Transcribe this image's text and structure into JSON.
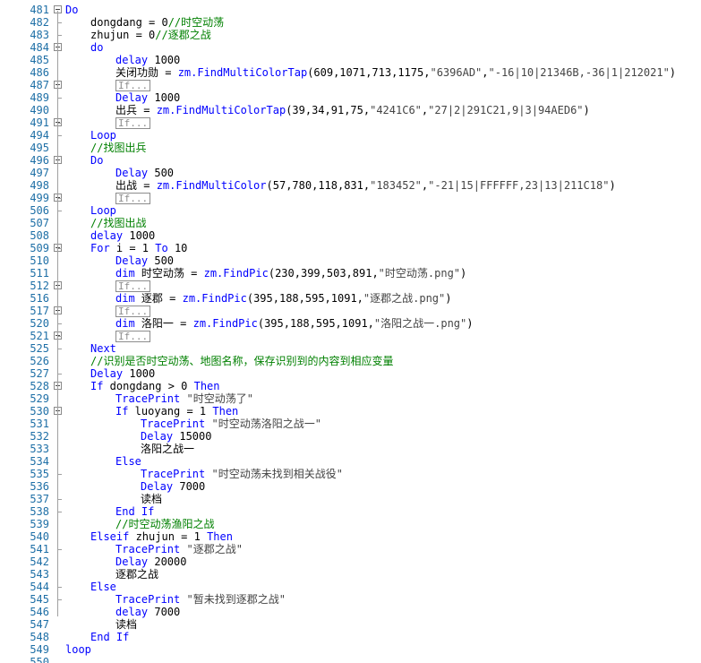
{
  "editor": {
    "lines": [
      {
        "n": "481",
        "indent": 0,
        "fold": true,
        "parts": [
          {
            "t": "kw",
            "v": "Do"
          }
        ]
      },
      {
        "n": "482",
        "indent": 1,
        "parts": [
          {
            "t": "plain",
            "v": "dongdang = 0"
          },
          {
            "t": "cm",
            "v": "//时空动荡"
          }
        ]
      },
      {
        "n": "483",
        "indent": 1,
        "parts": [
          {
            "t": "plain",
            "v": "zhujun = 0"
          },
          {
            "t": "cm",
            "v": "//逐郡之战"
          }
        ]
      },
      {
        "n": "484",
        "indent": 1,
        "fold": true,
        "parts": [
          {
            "t": "kw",
            "v": "do"
          }
        ]
      },
      {
        "n": "485",
        "indent": 2,
        "parts": [
          {
            "t": "kw",
            "v": "delay"
          },
          {
            "t": "plain",
            "v": " 1000"
          }
        ]
      },
      {
        "n": "486",
        "indent": 2,
        "parts": [
          {
            "t": "plain",
            "v": "关闭功勋 = "
          },
          {
            "t": "obj",
            "v": "zm.FindMultiColorTap"
          },
          {
            "t": "plain",
            "v": "(609,1071,713,1175,"
          },
          {
            "t": "str",
            "v": "\"6396AD\""
          },
          {
            "t": "plain",
            "v": ","
          },
          {
            "t": "str",
            "v": "\"-16|10|21346B,-36|1|212021\""
          },
          {
            "t": "plain",
            "v": ")"
          }
        ]
      },
      {
        "n": "487",
        "indent": 2,
        "fold": true,
        "parts": [
          {
            "t": "box",
            "v": "If..."
          }
        ]
      },
      {
        "n": "489",
        "indent": 2,
        "parts": [
          {
            "t": "kw",
            "v": "Delay"
          },
          {
            "t": "plain",
            "v": " 1000"
          }
        ]
      },
      {
        "n": "490",
        "indent": 2,
        "parts": [
          {
            "t": "plain",
            "v": "出兵 = "
          },
          {
            "t": "obj",
            "v": "zm.FindMultiColorTap"
          },
          {
            "t": "plain",
            "v": "(39,34,91,75,"
          },
          {
            "t": "str",
            "v": "\"4241C6\""
          },
          {
            "t": "plain",
            "v": ","
          },
          {
            "t": "str",
            "v": "\"27|2|291C21,9|3|94AED6\""
          },
          {
            "t": "plain",
            "v": ")"
          }
        ]
      },
      {
        "n": "491",
        "indent": 2,
        "fold": true,
        "parts": [
          {
            "t": "box",
            "v": "If..."
          }
        ]
      },
      {
        "n": "494",
        "indent": 1,
        "parts": [
          {
            "t": "kw",
            "v": "Loop"
          }
        ]
      },
      {
        "n": "495",
        "indent": 1,
        "parts": [
          {
            "t": "cm",
            "v": "//找图出兵"
          }
        ]
      },
      {
        "n": "496",
        "indent": 1,
        "fold": true,
        "parts": [
          {
            "t": "kw",
            "v": "Do"
          }
        ]
      },
      {
        "n": "497",
        "indent": 2,
        "parts": [
          {
            "t": "kw",
            "v": "Delay"
          },
          {
            "t": "plain",
            "v": " 500"
          }
        ]
      },
      {
        "n": "498",
        "indent": 2,
        "parts": [
          {
            "t": "plain",
            "v": "出战 = "
          },
          {
            "t": "obj",
            "v": "zm.FindMultiColor"
          },
          {
            "t": "plain",
            "v": "(57,780,118,831,"
          },
          {
            "t": "str",
            "v": "\"183452\""
          },
          {
            "t": "plain",
            "v": ","
          },
          {
            "t": "str",
            "v": "\"-21|15|FFFFFF,23|13|211C18\""
          },
          {
            "t": "plain",
            "v": ")"
          }
        ]
      },
      {
        "n": "499",
        "indent": 2,
        "fold": true,
        "parts": [
          {
            "t": "box",
            "v": "If..."
          }
        ]
      },
      {
        "n": "506",
        "indent": 1,
        "parts": [
          {
            "t": "kw",
            "v": "Loop"
          }
        ]
      },
      {
        "n": "507",
        "indent": 1,
        "parts": [
          {
            "t": "cm",
            "v": "//找图出战"
          }
        ]
      },
      {
        "n": "508",
        "indent": 1,
        "parts": [
          {
            "t": "kw",
            "v": "delay"
          },
          {
            "t": "plain",
            "v": " 1000"
          }
        ]
      },
      {
        "n": "509",
        "indent": 1,
        "fold": true,
        "parts": [
          {
            "t": "kw",
            "v": "For"
          },
          {
            "t": "plain",
            "v": " i = 1 "
          },
          {
            "t": "kw",
            "v": "To"
          },
          {
            "t": "plain",
            "v": " 10"
          }
        ]
      },
      {
        "n": "510",
        "indent": 2,
        "parts": [
          {
            "t": "kw",
            "v": "Delay"
          },
          {
            "t": "plain",
            "v": " 500"
          }
        ]
      },
      {
        "n": "511",
        "indent": 2,
        "parts": [
          {
            "t": "kw",
            "v": "dim"
          },
          {
            "t": "plain",
            "v": " 时空动荡 = "
          },
          {
            "t": "obj",
            "v": "zm.FindPic"
          },
          {
            "t": "plain",
            "v": "(230,399,503,891,"
          },
          {
            "t": "str",
            "v": "\"时空动荡.png\""
          },
          {
            "t": "plain",
            "v": ")"
          }
        ]
      },
      {
        "n": "512",
        "indent": 2,
        "fold": true,
        "parts": [
          {
            "t": "box",
            "v": "If..."
          }
        ]
      },
      {
        "n": "516",
        "indent": 2,
        "parts": [
          {
            "t": "kw",
            "v": "dim"
          },
          {
            "t": "plain",
            "v": " 逐郡 = "
          },
          {
            "t": "obj",
            "v": "zm.FindPic"
          },
          {
            "t": "plain",
            "v": "(395,188,595,1091,"
          },
          {
            "t": "str",
            "v": "\"逐郡之战.png\""
          },
          {
            "t": "plain",
            "v": ")"
          }
        ]
      },
      {
        "n": "517",
        "indent": 2,
        "fold": true,
        "parts": [
          {
            "t": "box",
            "v": "If..."
          }
        ]
      },
      {
        "n": "520",
        "indent": 2,
        "parts": [
          {
            "t": "kw",
            "v": "dim"
          },
          {
            "t": "plain",
            "v": " 洛阳一 = "
          },
          {
            "t": "obj",
            "v": "zm.FindPic"
          },
          {
            "t": "plain",
            "v": "(395,188,595,1091,"
          },
          {
            "t": "str",
            "v": "\"洛阳之战一.png\""
          },
          {
            "t": "plain",
            "v": ")"
          }
        ]
      },
      {
        "n": "521",
        "indent": 2,
        "fold": true,
        "parts": [
          {
            "t": "box",
            "v": "If..."
          }
        ]
      },
      {
        "n": "525",
        "indent": 1,
        "parts": [
          {
            "t": "kw",
            "v": "Next"
          }
        ]
      },
      {
        "n": "526",
        "indent": 1,
        "parts": [
          {
            "t": "cm",
            "v": "//识别是否时空动荡、地图名称，保存识别到的内容到相应变量"
          }
        ]
      },
      {
        "n": "527",
        "indent": 1,
        "parts": [
          {
            "t": "kw",
            "v": "Delay"
          },
          {
            "t": "plain",
            "v": " 1000"
          }
        ]
      },
      {
        "n": "528",
        "indent": 1,
        "fold": true,
        "parts": [
          {
            "t": "kw",
            "v": "If"
          },
          {
            "t": "plain",
            "v": " dongdang > 0 "
          },
          {
            "t": "kw",
            "v": "Then"
          }
        ]
      },
      {
        "n": "529",
        "indent": 2,
        "parts": [
          {
            "t": "kw",
            "v": "TracePrint"
          },
          {
            "t": "str",
            "v": " \"时空动荡了\""
          }
        ]
      },
      {
        "n": "530",
        "indent": 2,
        "fold": true,
        "parts": [
          {
            "t": "kw",
            "v": "If"
          },
          {
            "t": "plain",
            "v": " luoyang = 1 "
          },
          {
            "t": "kw",
            "v": "Then"
          }
        ]
      },
      {
        "n": "531",
        "indent": 3,
        "parts": [
          {
            "t": "kw",
            "v": "TracePrint"
          },
          {
            "t": "str",
            "v": " \"时空动荡洛阳之战一\""
          }
        ]
      },
      {
        "n": "532",
        "indent": 3,
        "parts": [
          {
            "t": "kw",
            "v": "Delay"
          },
          {
            "t": "plain",
            "v": " 15000"
          }
        ]
      },
      {
        "n": "533",
        "indent": 3,
        "parts": [
          {
            "t": "plain",
            "v": "洛阳之战一"
          }
        ]
      },
      {
        "n": "534",
        "indent": 2,
        "parts": [
          {
            "t": "kw",
            "v": "Else"
          }
        ]
      },
      {
        "n": "535",
        "indent": 3,
        "parts": [
          {
            "t": "kw",
            "v": "TracePrint"
          },
          {
            "t": "str",
            "v": " \"时空动荡未找到相关战役\""
          }
        ]
      },
      {
        "n": "536",
        "indent": 3,
        "parts": [
          {
            "t": "kw",
            "v": "Delay"
          },
          {
            "t": "plain",
            "v": " 7000"
          }
        ]
      },
      {
        "n": "537",
        "indent": 3,
        "parts": [
          {
            "t": "plain",
            "v": "读档"
          }
        ]
      },
      {
        "n": "538",
        "indent": 2,
        "parts": [
          {
            "t": "kw",
            "v": "End If"
          }
        ]
      },
      {
        "n": "539",
        "indent": 2,
        "parts": [
          {
            "t": "cm",
            "v": "//时空动荡渔阳之战"
          }
        ]
      },
      {
        "n": "540",
        "indent": 1,
        "parts": [
          {
            "t": "kw",
            "v": "Elseif"
          },
          {
            "t": "plain",
            "v": " zhujun = 1 "
          },
          {
            "t": "kw",
            "v": "Then"
          }
        ]
      },
      {
        "n": "541",
        "indent": 2,
        "parts": [
          {
            "t": "kw",
            "v": "TracePrint"
          },
          {
            "t": "str",
            "v": " \"逐郡之战\""
          }
        ]
      },
      {
        "n": "542",
        "indent": 2,
        "parts": [
          {
            "t": "kw",
            "v": "Delay"
          },
          {
            "t": "plain",
            "v": " 20000"
          }
        ]
      },
      {
        "n": "543",
        "indent": 2,
        "parts": [
          {
            "t": "plain",
            "v": "逐郡之战"
          }
        ]
      },
      {
        "n": "544",
        "indent": 1,
        "parts": [
          {
            "t": "kw",
            "v": "Else"
          }
        ]
      },
      {
        "n": "545",
        "indent": 2,
        "parts": [
          {
            "t": "kw",
            "v": "TracePrint"
          },
          {
            "t": "str",
            "v": " \"暂未找到逐郡之战\""
          }
        ]
      },
      {
        "n": "546",
        "indent": 2,
        "parts": [
          {
            "t": "kw",
            "v": "delay"
          },
          {
            "t": "plain",
            "v": " 7000"
          }
        ]
      },
      {
        "n": "547",
        "indent": 2,
        "parts": [
          {
            "t": "plain",
            "v": "读档"
          }
        ]
      },
      {
        "n": "548",
        "indent": 1,
        "parts": [
          {
            "t": "kw",
            "v": "End If"
          }
        ]
      },
      {
        "n": "549",
        "indent": 0,
        "parts": [
          {
            "t": "kw",
            "v": "loop"
          }
        ]
      },
      {
        "n": "550",
        "indent": 0,
        "parts": []
      }
    ]
  }
}
